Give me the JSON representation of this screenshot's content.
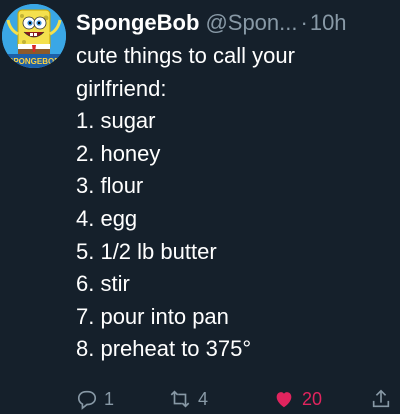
{
  "tweet": {
    "display_name": "SpongeBob",
    "handle": "@Spon...",
    "separator": "·",
    "time": "10h",
    "avatar": {
      "badge": "SPONGEBOB",
      "bg_color": "#3aa7e6"
    },
    "lines": [
      "cute things to call your",
      "girlfriend:",
      "1. sugar",
      "2. honey",
      "3. flour",
      "4. egg",
      "5. 1/2 lb butter",
      "6. stir",
      "7. pour into pan",
      "8. preheat to 375°"
    ],
    "actions": {
      "reply_count": "1",
      "retweet_count": "4",
      "like_count": "20"
    }
  },
  "colors": {
    "background": "#15202b",
    "text": "#ffffff",
    "muted": "#8899a6",
    "like": "#e0245e"
  }
}
